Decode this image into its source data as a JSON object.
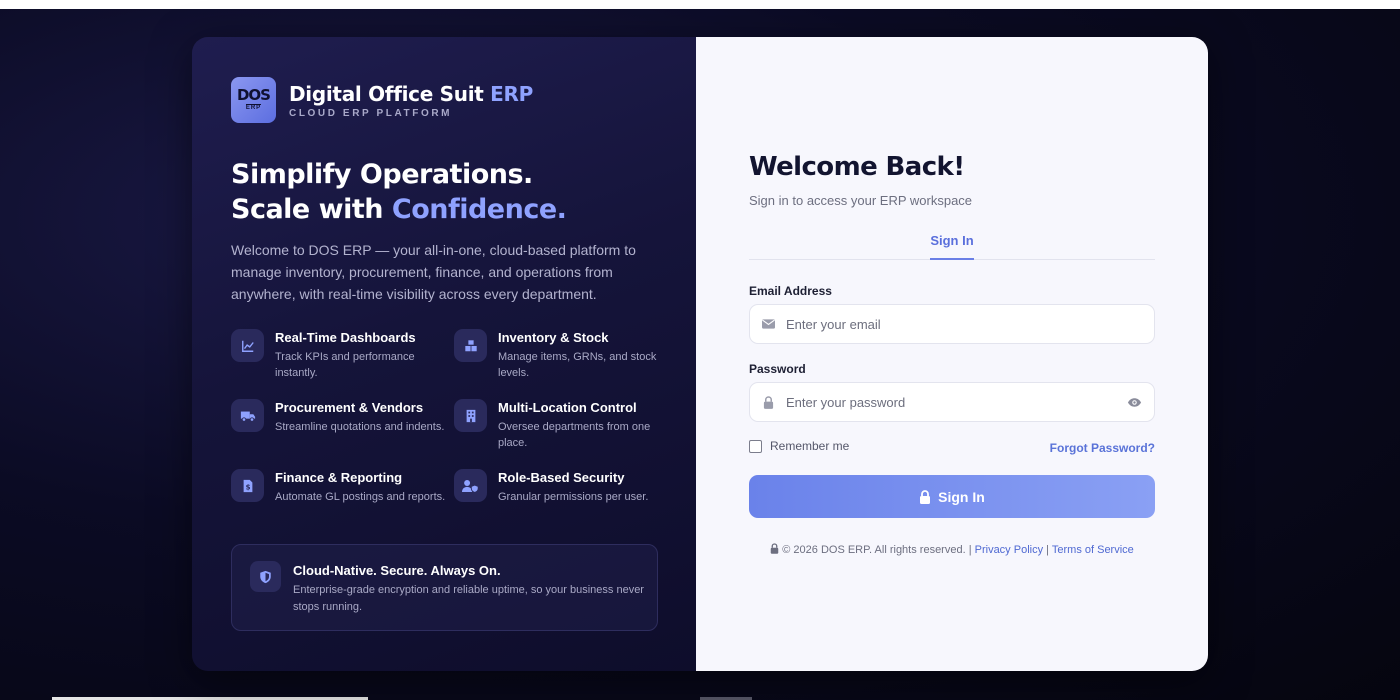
{
  "brand": {
    "logo_text": "DOS",
    "logo_sub": "ERP",
    "title_main": "Digital Office Suit ",
    "title_accent": "ERP",
    "subtitle": "CLOUD ERP PLATFORM"
  },
  "hero": {
    "line1": "Simplify Operations.",
    "line2_prefix": "Scale with ",
    "line2_accent": "Confidence.",
    "intro": "Welcome to DOS ERP — your all-in-one, cloud-based platform to manage inventory, procurement, finance, and operations from anywhere, with real-time visibility across every department."
  },
  "features": [
    {
      "icon": "chart-line-icon",
      "title": "Real-Time Dashboards",
      "desc": "Track KPIs and performance instantly."
    },
    {
      "icon": "boxes-icon",
      "title": "Inventory & Stock",
      "desc": "Manage items, GRNs, and stock levels."
    },
    {
      "icon": "truck-icon",
      "title": "Procurement & Vendors",
      "desc": "Streamline quotations and indents."
    },
    {
      "icon": "building-icon",
      "title": "Multi-Location Control",
      "desc": "Oversee departments from one place."
    },
    {
      "icon": "invoice-icon",
      "title": "Finance & Reporting",
      "desc": "Automate GL postings and reports."
    },
    {
      "icon": "user-shield-icon",
      "title": "Role-Based Security",
      "desc": "Granular permissions per user."
    }
  ],
  "cloud": {
    "title": "Cloud-Native. Secure. Always On.",
    "desc": "Enterprise-grade encryption and reliable uptime, so your business never stops running."
  },
  "login": {
    "heading": "Welcome Back!",
    "subheading": "Sign in to access your ERP workspace",
    "tab": "Sign In",
    "email_label": "Email Address",
    "email_placeholder": "Enter your email",
    "password_label": "Password",
    "password_placeholder": "Enter your password",
    "remember": "Remember me",
    "forgot": "Forgot Password?",
    "button": "Sign In"
  },
  "footer": {
    "copyright": "© 2026 DOS ERP. All rights reserved. |",
    "privacy": "Privacy Policy",
    "separator": "|",
    "terms": "Terms of Service"
  },
  "colors": {
    "accent": "#8fa2ff",
    "primary_button": "#6a82ea",
    "link": "#5a73d8",
    "left_panel": "#15143a",
    "right_panel": "#f7f7fd"
  }
}
